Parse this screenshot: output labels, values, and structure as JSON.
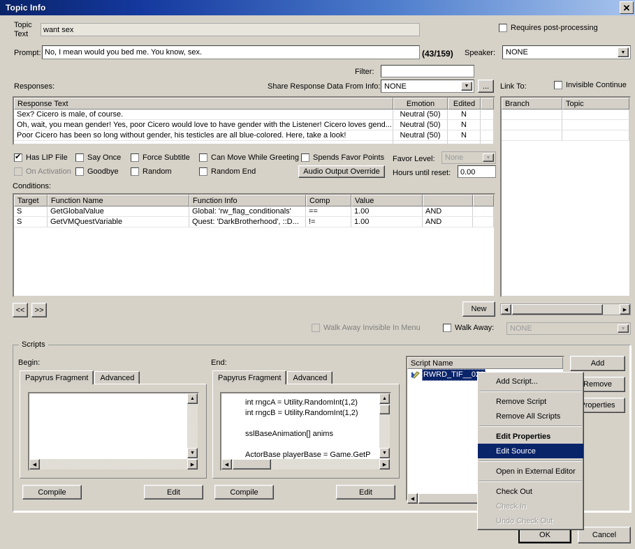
{
  "window": {
    "title": "Topic Info",
    "close_label": "✕"
  },
  "topic": {
    "text_label_line1": "Topic",
    "text_label_line2": "Text",
    "text_value": "want sex",
    "prompt_label": "Prompt:",
    "prompt_value": "No, I mean would you bed me. You know, sex.",
    "prompt_counter": "(43/159)",
    "requires_post_processing_label": "Requires post-processing",
    "speaker_label": "Speaker:",
    "speaker_value": "NONE",
    "filter_label": "Filter:",
    "filter_value": ""
  },
  "responses": {
    "label": "Responses:",
    "share_label": "Share Response Data From Info:",
    "share_value": "NONE",
    "browse_label": "...",
    "link_to_label": "Link To:",
    "invisible_continue_label": "Invisible Continue",
    "columns": [
      "Response Text",
      "Emotion",
      "Edited"
    ],
    "rows": [
      {
        "text": "Sex? Cicero is male, of course.",
        "emotion": "Neutral (50)",
        "edited": "N"
      },
      {
        "text": "Oh, wait, you mean gender! Yes, poor Cicero would love to have gender with the Listener! Cicero loves gend...",
        "emotion": "Neutral (50)",
        "edited": "N"
      },
      {
        "text": "Poor Cicero has been so long without gender, his testicles are all blue-colored. Here, take a look!",
        "emotion": "Neutral (50)",
        "edited": "N"
      }
    ]
  },
  "link_to": {
    "columns": [
      "Branch",
      "Topic"
    ],
    "rows": []
  },
  "flags": {
    "has_lip_file": "Has LIP File",
    "say_once": "Say Once",
    "force_subtitle": "Force Subtitle",
    "can_move_while_greeting": "Can Move While Greeting",
    "spends_favor_points": "Spends Favor Points",
    "on_activation": "On Activation",
    "goodbye": "Goodbye",
    "random": "Random",
    "random_end": "Random End",
    "favor_level_label": "Favor Level:",
    "favor_level_value": "None",
    "audio_output_override": "Audio Output Override",
    "hours_until_reset_label": "Hours until reset:",
    "hours_until_reset_value": "0.00"
  },
  "conditions": {
    "label": "Conditions:",
    "columns": [
      "Target",
      "Function Name",
      "Function Info",
      "Comp",
      "Value",
      "",
      ""
    ],
    "rows": [
      {
        "target": "S",
        "function_name": "GetGlobalValue",
        "function_info": "Global: 'rw_flag_conditionals'",
        "comp": "==",
        "value": "1.00",
        "logic": "AND"
      },
      {
        "target": "S",
        "function_name": "GetVMQuestVariable",
        "function_info": "Quest: 'DarkBrotherhood', ::D...",
        "comp": "!=",
        "value": "1.00",
        "logic": "AND"
      }
    ],
    "prev_label": "<<",
    "next_label": ">>",
    "new_label": "New"
  },
  "walk_away": {
    "invisible_in_menu_label": "Walk Away Invisible In Menu",
    "walk_away_label": "Walk Away:",
    "walk_away_value": "NONE"
  },
  "scripts": {
    "group_label": "Scripts",
    "begin_label": "Begin:",
    "end_label": "End:",
    "tab_papyrus": "Papyrus Fragment",
    "tab_advanced": "Advanced",
    "compile_label": "Compile",
    "edit_label": "Edit",
    "begin_code": "",
    "end_code": "int rngcA = Utility.RandomInt(1,2)\nint rngcB = Utility.RandomInt(1,2)\n\nsslBaseAnimation[] anims\n\nActorBase playerBase = Game.GetP",
    "script_name_header": "Script Name",
    "script_rows": [
      {
        "name": "RWRD_TIF__020"
      }
    ],
    "add_label": "Add",
    "remove_label": "Remove",
    "properties_label": "Properties"
  },
  "context_menu": {
    "items": [
      {
        "label": "Add Script...",
        "state": "normal"
      },
      {
        "label": "",
        "state": "separator"
      },
      {
        "label": "Remove Script",
        "state": "normal"
      },
      {
        "label": "Remove All Scripts",
        "state": "normal"
      },
      {
        "label": "",
        "state": "separator"
      },
      {
        "label": "Edit Properties",
        "state": "bold"
      },
      {
        "label": "Edit Source",
        "state": "highlighted"
      },
      {
        "label": "",
        "state": "separator"
      },
      {
        "label": "Open in External Editor",
        "state": "normal"
      },
      {
        "label": "",
        "state": "separator"
      },
      {
        "label": "Check Out",
        "state": "normal"
      },
      {
        "label": "Check In",
        "state": "disabled"
      },
      {
        "label": "Undo Check Out",
        "state": "disabled"
      }
    ]
  },
  "footer": {
    "ok_label": "OK",
    "cancel_label": "Cancel"
  },
  "colors": {
    "titlebar_start": "#0a246a",
    "titlebar_end": "#a8c4ec",
    "dialog_face": "#d6d2c8",
    "selection": "#0a246a",
    "disabled_text": "#808080"
  }
}
